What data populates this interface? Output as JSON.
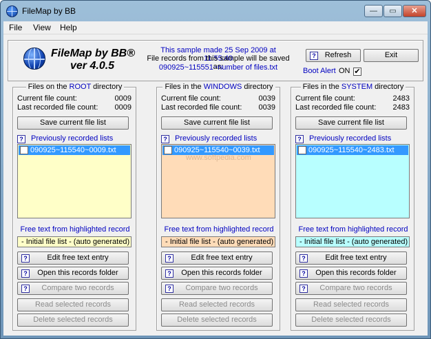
{
  "window": {
    "title": "FileMap by BB",
    "min": "—",
    "max": "▭",
    "close": "✕"
  },
  "menu": {
    "items": [
      "File",
      "View",
      "Help"
    ]
  },
  "header": {
    "logo_title": "FileMap by BB®",
    "logo_version": "ver 4.0.5",
    "sample_line1": "This sample made 25 Sep 2009 at 11:55:40",
    "sample_line2": "File records from this sample will be saved as:",
    "sample_line3": "090925~115551~number of files.txt",
    "refresh_label": "Refresh",
    "exit_label": "Exit",
    "boot_alert_label": "Boot Alert",
    "boot_alert_state": "ON",
    "boot_alert_check": "✔"
  },
  "common": {
    "help_mark": "?",
    "current_label": "Current file count:",
    "last_label": "Last recorded file count:",
    "save_label": "Save current file list",
    "prev_label": "Previously recorded  lists",
    "free_label": "Free text from highlighted record",
    "free_value": "- Initial file list - (auto generated)",
    "edit_label": "Edit free text entry",
    "open_label": "Open this records folder",
    "compare_label": "Compare two records",
    "read_label": "Read selected records",
    "delete_label": "Delete selected records"
  },
  "panels": [
    {
      "prefix": "Files on the ",
      "accent": "ROOT",
      "suffix": " directory",
      "current": "0009",
      "last": "0009",
      "record": "090925~115540~0009.txt",
      "bg": "#ffffc8",
      "free_bg": "#ffffc8"
    },
    {
      "prefix": "Files in the ",
      "accent": "WINDOWS",
      "suffix": " directory",
      "current": "0039",
      "last": "0039",
      "record": "090925~115540~0039.txt",
      "bg": "#ffdcb8",
      "free_bg": "#ffdcb8"
    },
    {
      "prefix": "Files in the ",
      "accent": "SYSTEM",
      "suffix": " directory",
      "current": "2483",
      "last": "2483",
      "record": "090925~115540~2483.txt",
      "bg": "#b8ffff",
      "free_bg": "#b8ffff"
    }
  ],
  "watermark": "www.softpedia.com"
}
